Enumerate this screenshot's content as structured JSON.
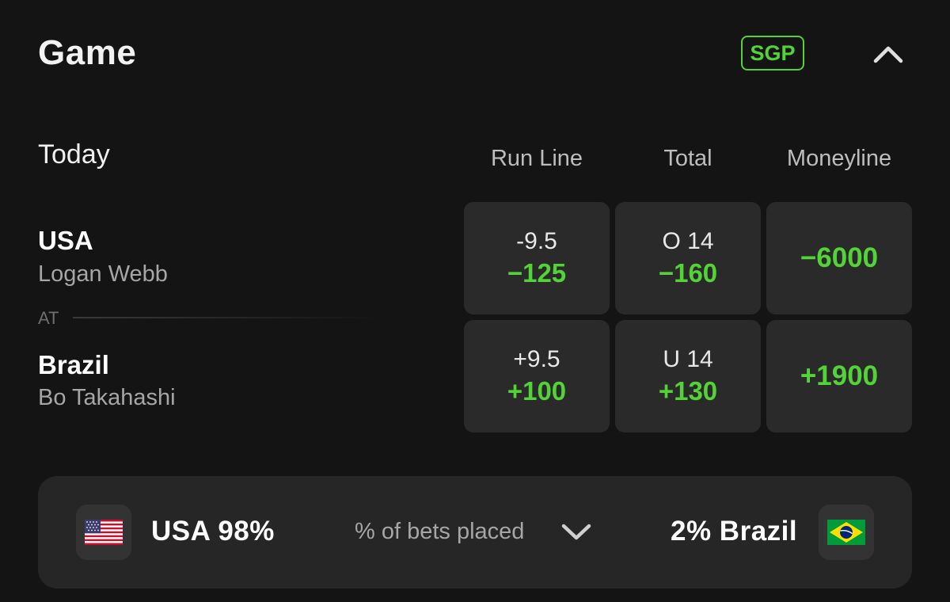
{
  "header": {
    "title": "Game",
    "sgp_label": "SGP",
    "accent_color": "#53d337"
  },
  "market_headers": {
    "date_label": "Today",
    "columns": [
      "Run Line",
      "Total",
      "Moneyline"
    ]
  },
  "teams": [
    {
      "name": "USA",
      "pitcher": "Logan Webb",
      "run_line": {
        "line": "-9.5",
        "odds": "−125"
      },
      "total": {
        "line": "O 14",
        "odds": "−160"
      },
      "moneyline": {
        "odds": "−6000"
      }
    },
    {
      "name": "Brazil",
      "pitcher": "Bo Takahashi",
      "run_line": {
        "line": "+9.5",
        "odds": "+100"
      },
      "total": {
        "line": "U 14",
        "odds": "+130"
      },
      "moneyline": {
        "odds": "+1900"
      }
    }
  ],
  "separator_label": "AT",
  "bets_placed": {
    "left_team": "USA 98%",
    "label": "% of bets placed",
    "right_team": "2% Brazil",
    "left_flag_icon": "usa-flag-icon",
    "right_flag_icon": "brazil-flag-icon"
  },
  "icons": {
    "collapse": "chevron-up-icon",
    "expand": "chevron-down-icon"
  }
}
